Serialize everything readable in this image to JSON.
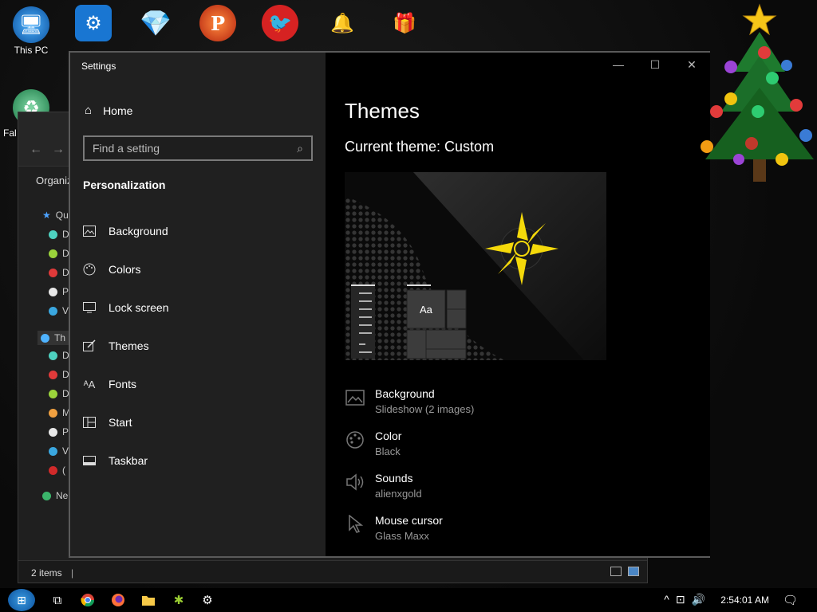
{
  "desktop": {
    "icons": [
      {
        "label": "This PC",
        "glyph": "🖥"
      },
      {
        "label": "",
        "glyph": "⚙"
      },
      {
        "label": "",
        "glyph": "💎"
      },
      {
        "label": "",
        "glyph": "P"
      },
      {
        "label": "",
        "glyph": "🐦"
      },
      {
        "label": "",
        "glyph": "🔔"
      },
      {
        "label": "",
        "glyph": "🎁"
      },
      {
        "label": "Fal",
        "glyph": "♻"
      }
    ]
  },
  "explorer": {
    "organize_label": "Organiz",
    "status_text": "2 items",
    "tree_items": [
      "Qu",
      "D",
      "D",
      "D",
      "P",
      "V",
      "Th",
      "D",
      "D",
      "D",
      "M",
      "P",
      "V",
      "(",
      "Ne"
    ]
  },
  "settings": {
    "window_title": "Settings",
    "controls": {
      "minimize": "—",
      "maximize": "☐",
      "close": "✕"
    },
    "home_label": "Home",
    "search_placeholder": "Find a setting",
    "section_title": "Personalization",
    "nav_items": [
      {
        "label": "Background",
        "icon": "picture-icon"
      },
      {
        "label": "Colors",
        "icon": "palette-icon"
      },
      {
        "label": "Lock screen",
        "icon": "monitor-icon"
      },
      {
        "label": "Themes",
        "icon": "brush-icon"
      },
      {
        "label": "Fonts",
        "icon": "font-icon"
      },
      {
        "label": "Start",
        "icon": "start-icon"
      },
      {
        "label": "Taskbar",
        "icon": "taskbar-icon"
      }
    ],
    "page_title": "Themes",
    "current_theme": "Current theme: Custom",
    "preview_sample_text": "Aa",
    "properties": [
      {
        "name": "Background",
        "value": "Slideshow (2 images)",
        "icon": "picture-icon"
      },
      {
        "name": "Color",
        "value": "Black",
        "icon": "palette-icon"
      },
      {
        "name": "Sounds",
        "value": "alienxgold",
        "icon": "speaker-icon"
      },
      {
        "name": "Mouse cursor",
        "value": "Glass Maxx",
        "icon": "cursor-icon"
      }
    ]
  },
  "taskbar": {
    "clock": "2:54:01 AM",
    "apps": [
      "start-orb",
      "task-view",
      "chrome",
      "firefox",
      "file-explorer",
      "game-app",
      "settings-app"
    ]
  },
  "colors": {
    "sidebar_bg": "#202020",
    "main_bg": "#000000",
    "accent_yellow": "#f5d90a"
  }
}
